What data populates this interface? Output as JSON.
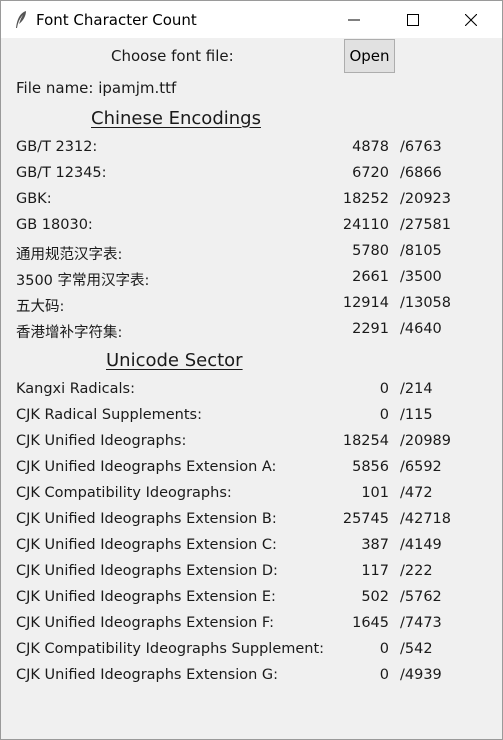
{
  "window": {
    "title": "Font Character Count"
  },
  "file": {
    "choose_label": "Choose font file:",
    "open_button": "Open",
    "file_name": "File name: ipamjm.ttf"
  },
  "chinese": {
    "heading": "Chinese Encodings",
    "rows": [
      {
        "label": "GB/T 2312:",
        "count": "4878",
        "total": "/6763"
      },
      {
        "label": "GB/T 12345:",
        "count": "6720",
        "total": "/6866"
      },
      {
        "label": "GBK:",
        "count": "18252",
        "total": "/20923"
      },
      {
        "label": "GB 18030:",
        "count": "24110",
        "total": "/27581"
      },
      {
        "label": "通用规范汉字表:",
        "count": "5780",
        "total": "/8105"
      },
      {
        "label": "3500 字常用汉字表:",
        "count": "2661",
        "total": "/3500"
      },
      {
        "label": "五大码:",
        "count": "12914",
        "total": "/13058"
      },
      {
        "label": "香港增补字符集:",
        "count": "2291",
        "total": "/4640"
      }
    ]
  },
  "unicode": {
    "heading": "Unicode Sector",
    "rows": [
      {
        "label": "Kangxi Radicals:",
        "count": "0",
        "total": "/214"
      },
      {
        "label": "CJK Radical Supplements:",
        "count": "0",
        "total": "/115"
      },
      {
        "label": "CJK Unified Ideographs:",
        "count": "18254",
        "total": "/20989"
      },
      {
        "label": "CJK Unified Ideographs Extension A:",
        "count": "5856",
        "total": "/6592"
      },
      {
        "label": "CJK Compatibility Ideographs:",
        "count": "101",
        "total": "/472"
      },
      {
        "label": "CJK Unified Ideographs Extension B:",
        "count": "25745",
        "total": "/42718"
      },
      {
        "label": "CJK Unified Ideographs Extension C:",
        "count": "387",
        "total": "/4149"
      },
      {
        "label": "CJK Unified Ideographs Extension D:",
        "count": "117",
        "total": "/222"
      },
      {
        "label": "CJK Unified Ideographs Extension E:",
        "count": "502",
        "total": "/5762"
      },
      {
        "label": "CJK Unified Ideographs Extension F:",
        "count": "1645",
        "total": "/7473"
      },
      {
        "label": "CJK Compatibility Ideographs Supplement:",
        "count": "0",
        "total": "/542"
      },
      {
        "label": "CJK Unified Ideographs Extension G:",
        "count": "0",
        "total": "/4939"
      }
    ]
  }
}
